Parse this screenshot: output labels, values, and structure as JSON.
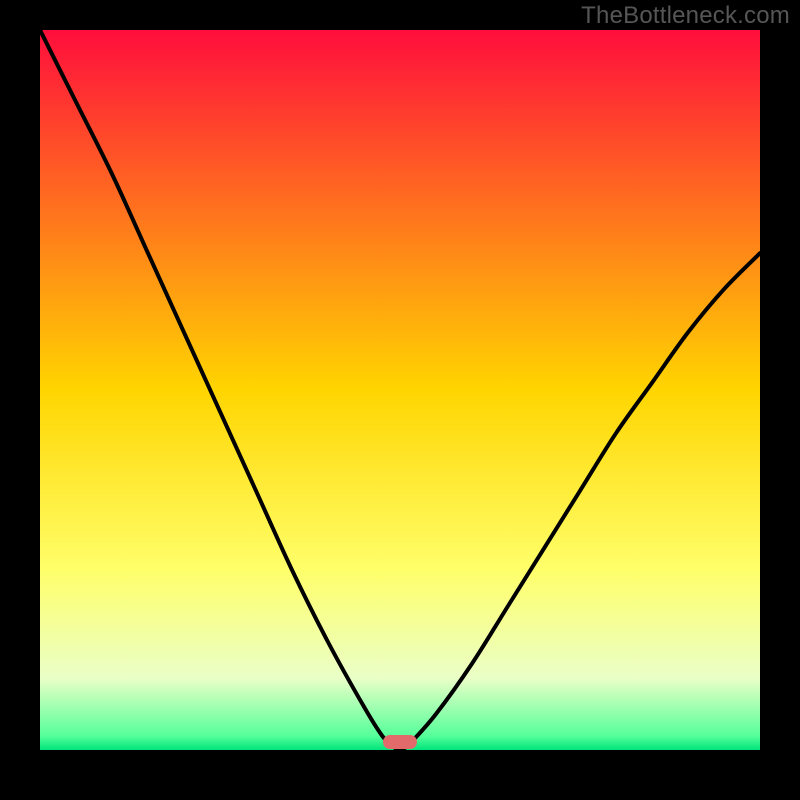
{
  "branding": {
    "watermark": "TheBottleneck.com"
  },
  "chart_data": {
    "type": "line",
    "title": "",
    "xlabel": "",
    "ylabel": "",
    "x": [
      0.0,
      0.05,
      0.1,
      0.15,
      0.2,
      0.25,
      0.3,
      0.35,
      0.4,
      0.45,
      0.475,
      0.49,
      0.5,
      0.51,
      0.515,
      0.55,
      0.6,
      0.65,
      0.7,
      0.75,
      0.8,
      0.85,
      0.9,
      0.95,
      1.0
    ],
    "values": [
      100,
      90,
      80,
      69,
      58,
      47,
      36,
      25,
      15,
      6,
      2,
      0.5,
      0,
      0.5,
      1,
      5,
      12,
      20,
      28,
      36,
      44,
      51,
      58,
      64,
      69
    ],
    "xlim": [
      0,
      1
    ],
    "ylim": [
      0,
      100
    ],
    "background_gradient_stops": [
      {
        "offset": 0.0,
        "color": "#ff0e3c"
      },
      {
        "offset": 0.5,
        "color": "#ffd500"
      },
      {
        "offset": 0.75,
        "color": "#ffff6a"
      },
      {
        "offset": 0.9,
        "color": "#eaffc7"
      },
      {
        "offset": 0.98,
        "color": "#57ff9b"
      },
      {
        "offset": 1.0,
        "color": "#00e57a"
      }
    ],
    "marker": {
      "x_frac": 0.5,
      "y_frac": 0.0,
      "color": "#e26a6a",
      "semantic": "optimal-point"
    }
  }
}
